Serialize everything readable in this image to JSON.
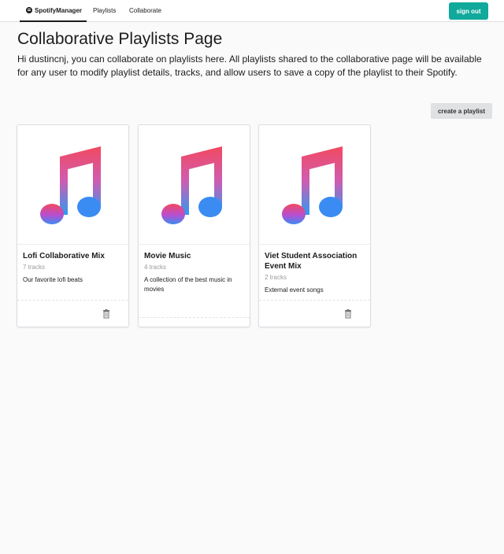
{
  "nav": {
    "brand": "SpotifyManager",
    "items": [
      {
        "label": "Playlists"
      },
      {
        "label": "Collaborate"
      }
    ],
    "signout_label": "sign out"
  },
  "page": {
    "title": "Collaborative Playlists Page",
    "description": "Hi dustincnj, you can collaborate on playlists here. All playlists shared to the collaborative page will be available for any user to modify playlist details, tracks, and allow users to save a copy of the playlist to their Spotify.",
    "create_label": "create a playlist"
  },
  "playlists": [
    {
      "name": "Lofi Collaborative Mix",
      "tracks": "7 tracks",
      "description": "Our favorite lofi beats",
      "has_delete": true
    },
    {
      "name": "Movie Music",
      "tracks": "4 tracks",
      "description": "A collection of the best music in movies",
      "has_delete": false
    },
    {
      "name": "Viet Student Association Event Mix",
      "tracks": "2 tracks",
      "description": "External event songs",
      "has_delete": true
    }
  ],
  "colors": {
    "accent": "#10a99c",
    "note_top": "#f2495f",
    "note_mid": "#a250d8",
    "note_bottom": "#2f9af2"
  },
  "icons": {
    "playlist_art": "music-note-icon",
    "delete": "trash-icon"
  }
}
